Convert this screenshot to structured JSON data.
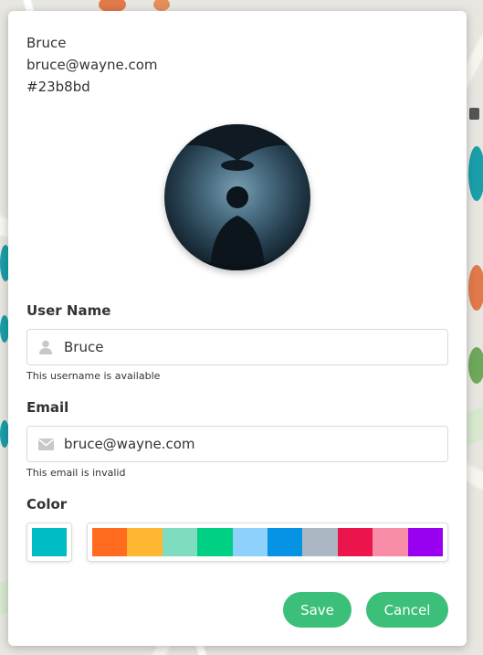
{
  "profile": {
    "name": "Bruce",
    "email": "bruce@wayne.com",
    "color_hex": "#23b8bd"
  },
  "form": {
    "username_label": "User Name",
    "username_value": "Bruce",
    "username_hint": "This username is available",
    "email_label": "Email",
    "email_value": "bruce@wayne.com",
    "email_hint": "This email is invalid",
    "color_label": "Color"
  },
  "colors": {
    "current": "#00bcc4",
    "palette": [
      "#ff6b1f",
      "#ffb630",
      "#7fdcc0",
      "#00d084",
      "#8ed1fc",
      "#0693e3",
      "#abb8c3",
      "#eb144c",
      "#f78da7",
      "#9900ef"
    ]
  },
  "icons": {
    "user": "user-icon",
    "email": "envelope-icon"
  },
  "actions": {
    "save_label": "Save",
    "cancel_label": "Cancel"
  }
}
